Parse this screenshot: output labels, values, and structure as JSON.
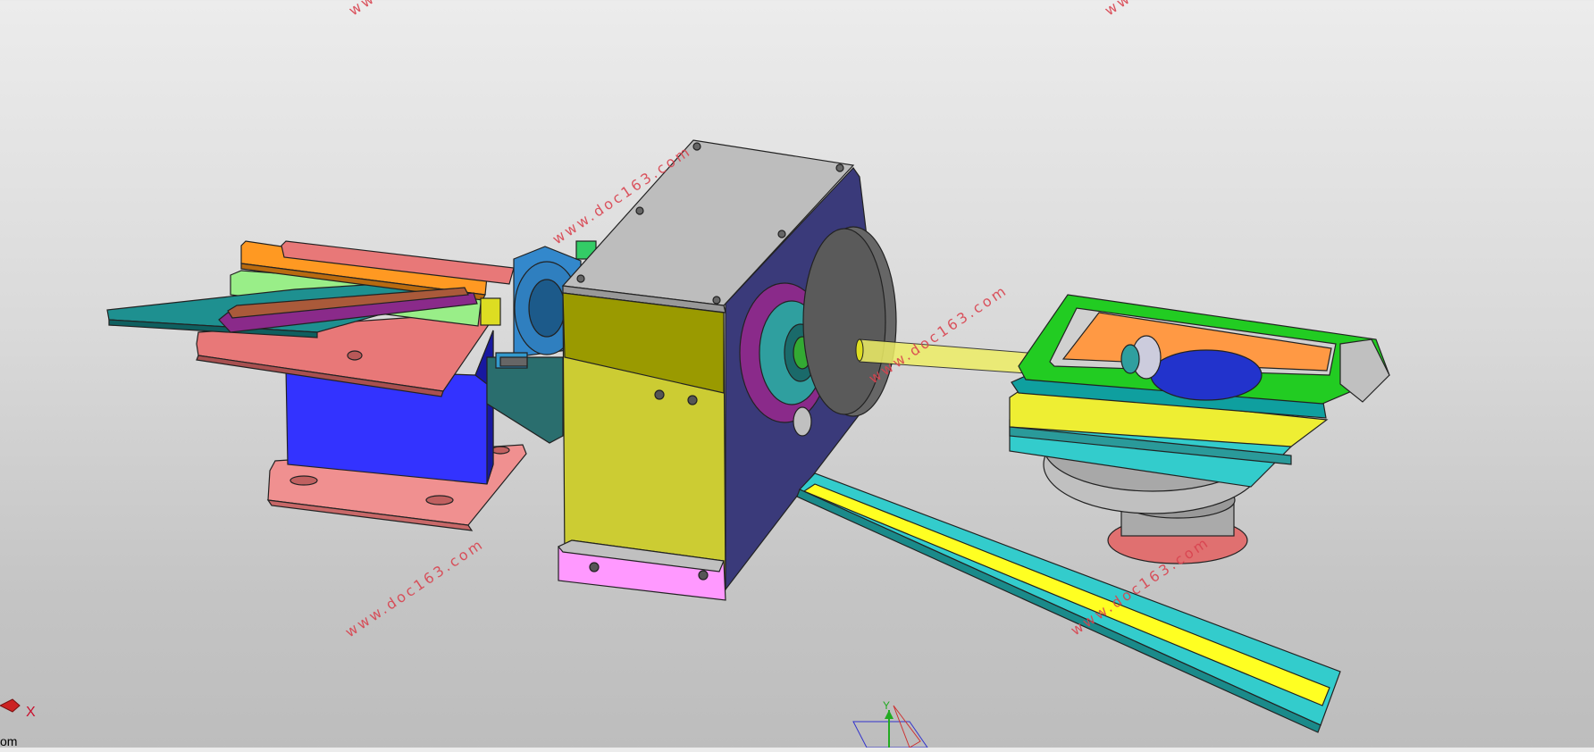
{
  "watermark": "www.doc163.com",
  "triad": {
    "x_label": "X",
    "y_label": "Y"
  },
  "corner_text": "om",
  "colors": {
    "background_top": "#ececec",
    "background_bottom": "#bdbdbd",
    "watermark": "#d9434f",
    "housing_yellow": "#cccc33",
    "housing_blue": "#3a3a7a",
    "housing_top": "#bdbdbd",
    "frame_green": "#22cc22",
    "chute_cyan": "#33cccc",
    "block_blue": "#3333ff",
    "plate_salmon": "#e88080"
  }
}
